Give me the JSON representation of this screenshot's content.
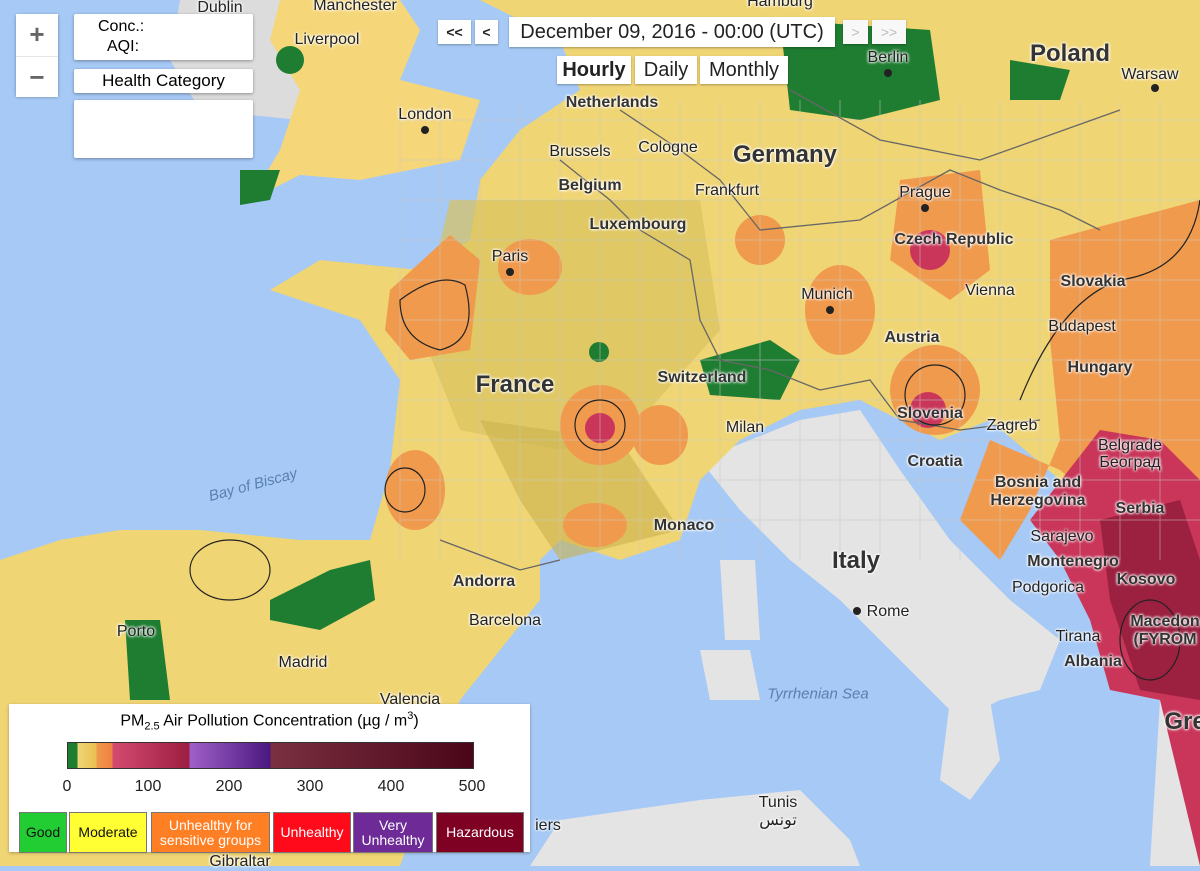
{
  "zoom": {
    "in": "+",
    "out": "−"
  },
  "info": {
    "conc_label": "Conc.:",
    "aqi_label": "AQI:",
    "health_label": "Health Category",
    "health_value": ""
  },
  "time": {
    "first": "<<",
    "prev": "<",
    "date": "December 09, 2016 - 00:00 (UTC)",
    "next": ">",
    "last": ">>"
  },
  "modes": {
    "items": [
      "Hourly",
      "Daily",
      "Monthly"
    ],
    "selected": "Hourly"
  },
  "map": {
    "labels": [
      "Manchester",
      "Liverpool",
      "London",
      "Dublin",
      "Poland",
      "Warsaw",
      "Berlin",
      "Hamburg",
      "Netherlands",
      "Brussels",
      "Cologne",
      "Germany",
      "Belgium",
      "Frankfurt",
      "Prague",
      "Luxembourg",
      "Czech Republic",
      "Paris",
      "Slovakia",
      "Munich",
      "Vienna",
      "Austria",
      "Budapest",
      "Hungary",
      "France",
      "Switzerland",
      "Slovenia",
      "Zagreb",
      "Milan",
      "Croatia",
      "Belgrade",
      "Београд",
      "Bay of Biscay",
      "Bosnia and",
      "Herzegovina",
      "Serbia",
      "Monaco",
      "Sarajevo",
      "Italy",
      "Montenegro",
      "Andorra",
      "Podgorica",
      "Kosovo",
      "Barcelona",
      "Rome",
      "Porto",
      "Macedon",
      "(FYROM",
      "Tirana",
      "Madrid",
      "Albania",
      "Tyrrhenian Sea",
      "Gre",
      "Tunis",
      "تونس",
      "iers",
      "Gibraltar",
      "Valencia"
    ]
  },
  "legend": {
    "title_pre": "PM",
    "title_sub": "2.5",
    "title_post": " Air Pollution Concentration (µg / m",
    "title_sup": "3",
    "title_end": ")",
    "ticks": [
      "0",
      "100",
      "200",
      "300",
      "400",
      "500"
    ],
    "range": [
      0,
      500
    ],
    "categories": [
      {
        "label": "Good",
        "color": "#22cc33",
        "text": "#111"
      },
      {
        "label": "Moderate",
        "color": "#ffff33",
        "text": "#111"
      },
      {
        "label": "Unhealthy for sensitive groups",
        "color": "#ff7f24",
        "text": "#fff"
      },
      {
        "label": "Unhealthy",
        "color": "#ff0a1a",
        "text": "#fff"
      },
      {
        "label": "Very Unhealthy",
        "color": "#6e2a96",
        "text": "#fff"
      },
      {
        "label": "Hazardous",
        "color": "#7e0023",
        "text": "#fff"
      }
    ]
  }
}
